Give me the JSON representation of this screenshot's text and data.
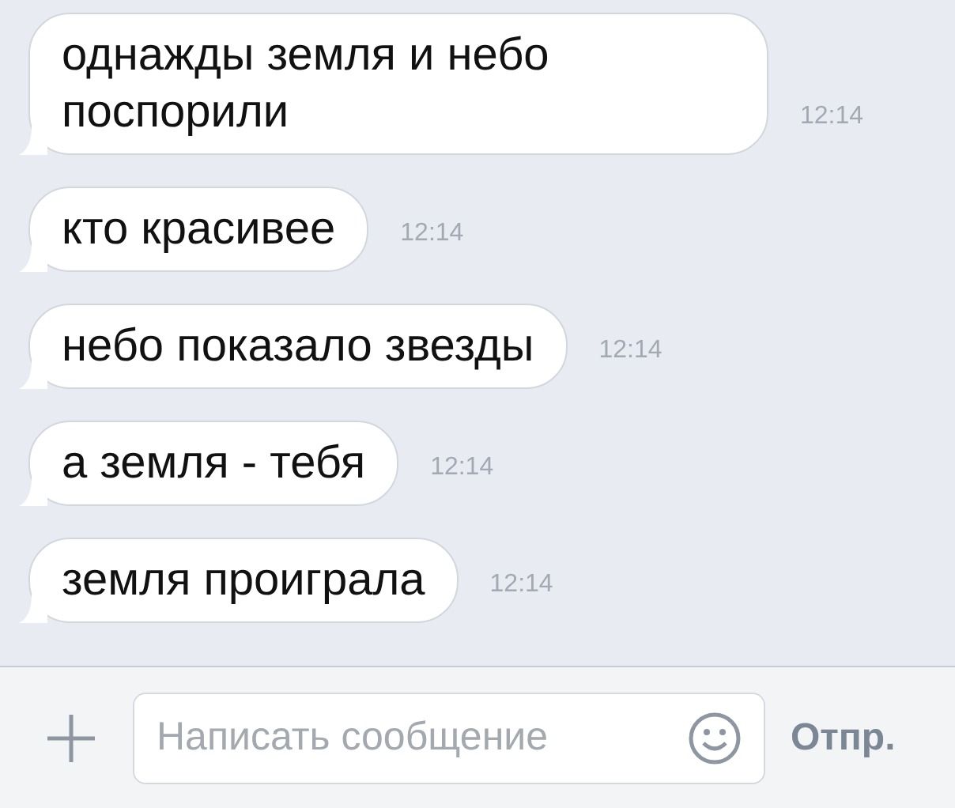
{
  "messages": [
    {
      "text": "однажды земля и небо поспорили",
      "time": "12:14"
    },
    {
      "text": "кто красивее",
      "time": "12:14"
    },
    {
      "text": "небо показало звезды",
      "time": "12:14"
    },
    {
      "text": "а земля - тебя",
      "time": "12:14"
    },
    {
      "text": "земля проиграла",
      "time": "12:14"
    }
  ],
  "composer": {
    "placeholder": "Написать сообщение",
    "send": "Отпр."
  }
}
